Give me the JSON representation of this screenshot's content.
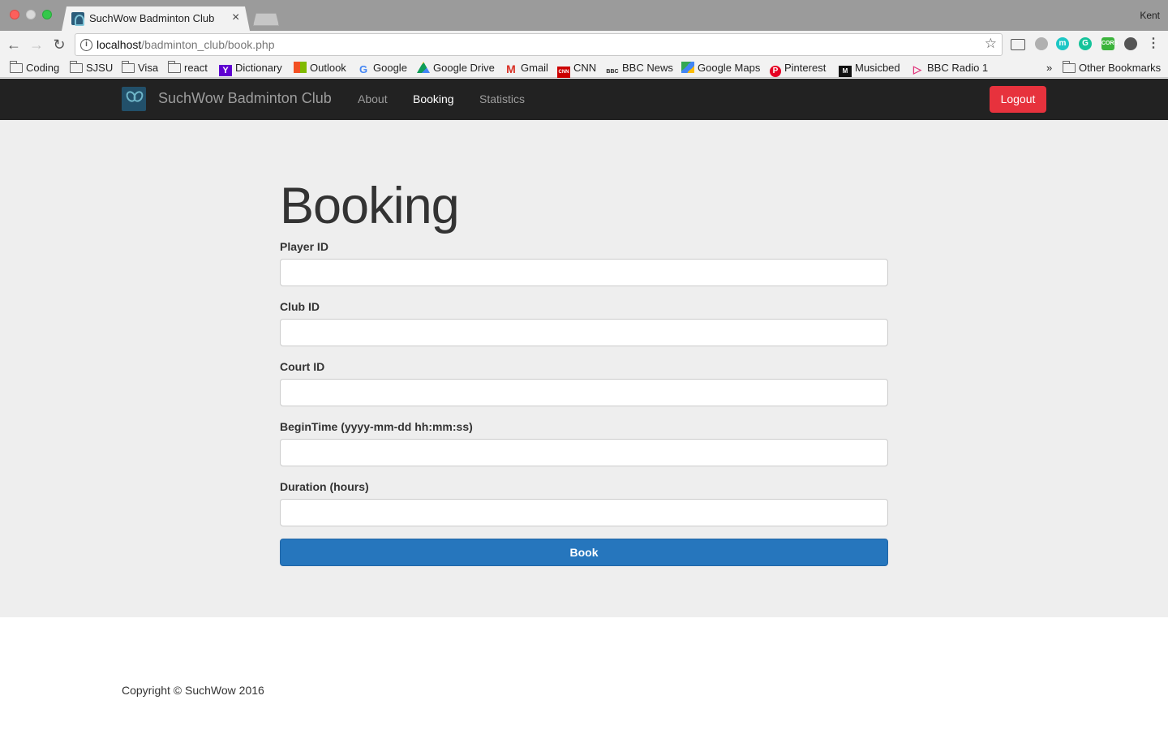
{
  "browser": {
    "tab_title": "SuchWow Badminton Club",
    "tab_close": "×",
    "profile": "Kent",
    "url_host": "localhost",
    "url_path": "/badminton_club/book.php",
    "bookmarks": [
      {
        "label": "Coding",
        "icon": "folder-icon"
      },
      {
        "label": "SJSU",
        "icon": "folder-icon"
      },
      {
        "label": "Visa",
        "icon": "folder-icon"
      },
      {
        "label": "react",
        "icon": "folder-icon"
      },
      {
        "label": "Dictionary",
        "icon": "yahoo-icon"
      },
      {
        "label": "Outlook",
        "icon": "microsoft-icon"
      },
      {
        "label": "Google",
        "icon": "google-icon"
      },
      {
        "label": "Google Drive",
        "icon": "google-drive-icon"
      },
      {
        "label": "Gmail",
        "icon": "gmail-icon"
      },
      {
        "label": "CNN",
        "icon": "cnn-icon"
      },
      {
        "label": "BBC News",
        "icon": "bbc-icon"
      },
      {
        "label": "Google Maps",
        "icon": "google-maps-icon"
      },
      {
        "label": "Pinterest",
        "icon": "pinterest-icon"
      },
      {
        "label": "Musicbed",
        "icon": "musicbed-icon"
      },
      {
        "label": "BBC Radio 1",
        "icon": "bbc-radio-icon"
      }
    ],
    "overflow": "»",
    "other_bookmarks": "Other Bookmarks"
  },
  "navbar": {
    "brand": "SuchWow Badminton Club",
    "links": [
      {
        "label": "About",
        "active": false
      },
      {
        "label": "Booking",
        "active": true
      },
      {
        "label": "Statistics",
        "active": false
      }
    ],
    "logout_label": "Logout"
  },
  "form": {
    "title": "Booking",
    "fields": [
      {
        "label": "Player ID",
        "value": ""
      },
      {
        "label": "Club ID",
        "value": ""
      },
      {
        "label": "Court ID",
        "value": ""
      },
      {
        "label": "BeginTime (yyyy-mm-dd hh:mm:ss)",
        "value": ""
      },
      {
        "label": "Duration (hours)",
        "value": ""
      }
    ],
    "submit_label": "Book"
  },
  "footer": {
    "copyright": "Copyright © SuchWow 2016"
  },
  "colors": {
    "navbar_bg": "#222222",
    "logout": "#e7323d",
    "primary": "#2676bd",
    "main_bg": "#eeeeee"
  }
}
